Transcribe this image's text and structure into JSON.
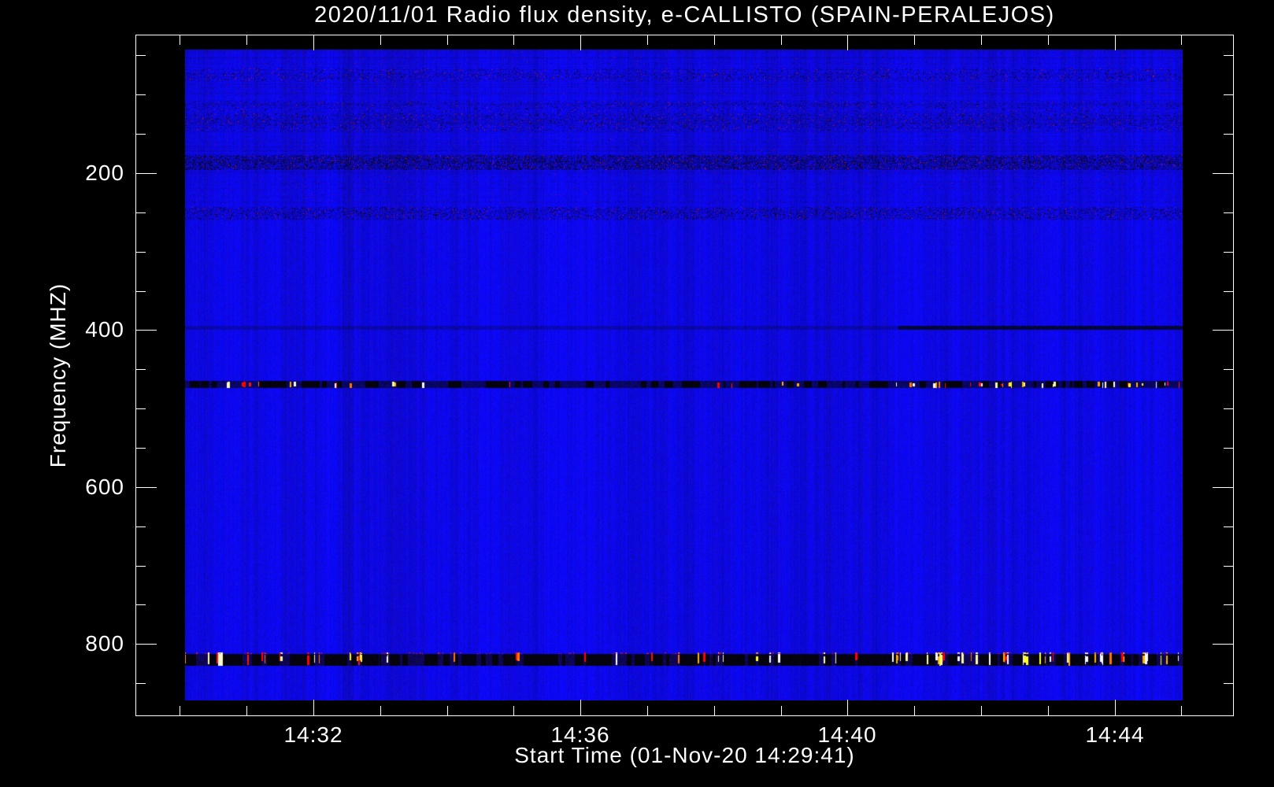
{
  "window": {
    "background": "#000000",
    "foreground": "#ffffff"
  },
  "chart_data": {
    "type": "heatmap",
    "subtype": "radio-spectrogram",
    "title": "2020/11/01  Radio flux density, e-CALLISTO (SPAIN-PERALEJOS)",
    "xlabel": "Start Time (01-Nov-20 14:29:41)",
    "ylabel": "Frequency (MHZ)",
    "legend": "none",
    "grid": "off",
    "x_axis": {
      "unit": "time HH:MM",
      "range_minutes_after_1400": [
        29.335,
        45.785
      ],
      "minor_tick_minutes": [
        30,
        31,
        33,
        34,
        35,
        37,
        38,
        39,
        41,
        42,
        43,
        45
      ],
      "major_ticks": [
        {
          "minute": 32,
          "label": "14:32"
        },
        {
          "minute": 36,
          "label": "14:36"
        },
        {
          "minute": 40,
          "label": "14:40"
        },
        {
          "minute": 44,
          "label": "14:44"
        }
      ]
    },
    "y_axis": {
      "unit": "MHz",
      "direction": "increasing-downward",
      "range": [
        23.6,
        891.9
      ],
      "minor_tick_mhz": [
        50,
        100,
        150,
        250,
        300,
        350,
        450,
        500,
        550,
        650,
        700,
        750,
        850
      ],
      "major_ticks": [
        {
          "mhz": 200,
          "label": "200"
        },
        {
          "mhz": 400,
          "label": "400"
        },
        {
          "mhz": 600,
          "label": "600"
        },
        {
          "mhz": 800,
          "label": "800"
        }
      ]
    },
    "image": {
      "time_range_minutes": [
        30.0,
        45.0
      ],
      "freq_range_mhz": [
        43,
        871
      ],
      "base_color": "#0a08e1",
      "col_variation": 30,
      "pixel_variation": 22,
      "texture_freq_limit_mhz": 262,
      "seed": 1234567
    },
    "palette": {
      "bright": [
        "#ff1800",
        "#ff0000",
        "#ff7800",
        "#ffb000",
        "#ffff30",
        "#ffffa8",
        "#ffffff"
      ],
      "navy_min_blue": 45,
      "navy_span_blue": 75,
      "red_speckle": "#a81414"
    },
    "bands": [
      {
        "name": "vhf-75",
        "f_lo": 67,
        "f_hi": 83,
        "style": "speckle",
        "dark_density": 0.12,
        "black_density": 0.02,
        "red_density": 0.014
      },
      {
        "name": "vhf-118",
        "f_lo": 108,
        "f_hi": 122,
        "style": "speckle",
        "dark_density": 0.1,
        "black_density": 0.012,
        "red_density": 0.008
      },
      {
        "name": "vhf-135",
        "f_lo": 124,
        "f_hi": 146,
        "style": "speckle",
        "dark_density": 0.13,
        "black_density": 0.022,
        "red_density": 0.015
      },
      {
        "name": "dab-186",
        "f_lo": 177,
        "f_hi": 196,
        "style": "speckle",
        "dark_density": 0.34,
        "black_density": 0.11,
        "red_density": 0.02
      },
      {
        "name": "band-251",
        "f_lo": 243,
        "f_hi": 259,
        "style": "speckle",
        "dark_density": 0.18,
        "black_density": 0.045,
        "red_density": 0.016
      },
      {
        "name": "line-398",
        "f_lo": 394,
        "f_hi": 399,
        "style": "darkline",
        "x_split": 0.715,
        "left_alpha": 0.22,
        "right_alpha": 0.7
      },
      {
        "name": "uhf-470",
        "f_lo": 465,
        "f_hi": 474,
        "style": "rfi",
        "thick": false,
        "dark_density": 0.5,
        "segments": [
          {
            "x0": 0.0,
            "x1": 0.215,
            "density": 0.38
          },
          {
            "x0": 0.215,
            "x1": 0.5,
            "density": 0.1
          },
          {
            "x0": 0.5,
            "x1": 0.695,
            "density": 0.16
          },
          {
            "x0": 0.695,
            "x1": 1.0,
            "density": 0.62
          }
        ]
      },
      {
        "name": "lte-819",
        "f_lo": 810,
        "f_hi": 827,
        "style": "rfi",
        "thick": true,
        "dark_density": 0.9,
        "top_speckle": true,
        "segments": [
          {
            "x0": 0.0,
            "x1": 0.18,
            "density": 0.45
          },
          {
            "x0": 0.18,
            "x1": 0.5,
            "density": 0.38
          },
          {
            "x0": 0.5,
            "x1": 1.0,
            "density": 0.78
          }
        ],
        "blobs": [
          {
            "x": 0.0332,
            "w": 6
          }
        ]
      }
    ]
  }
}
